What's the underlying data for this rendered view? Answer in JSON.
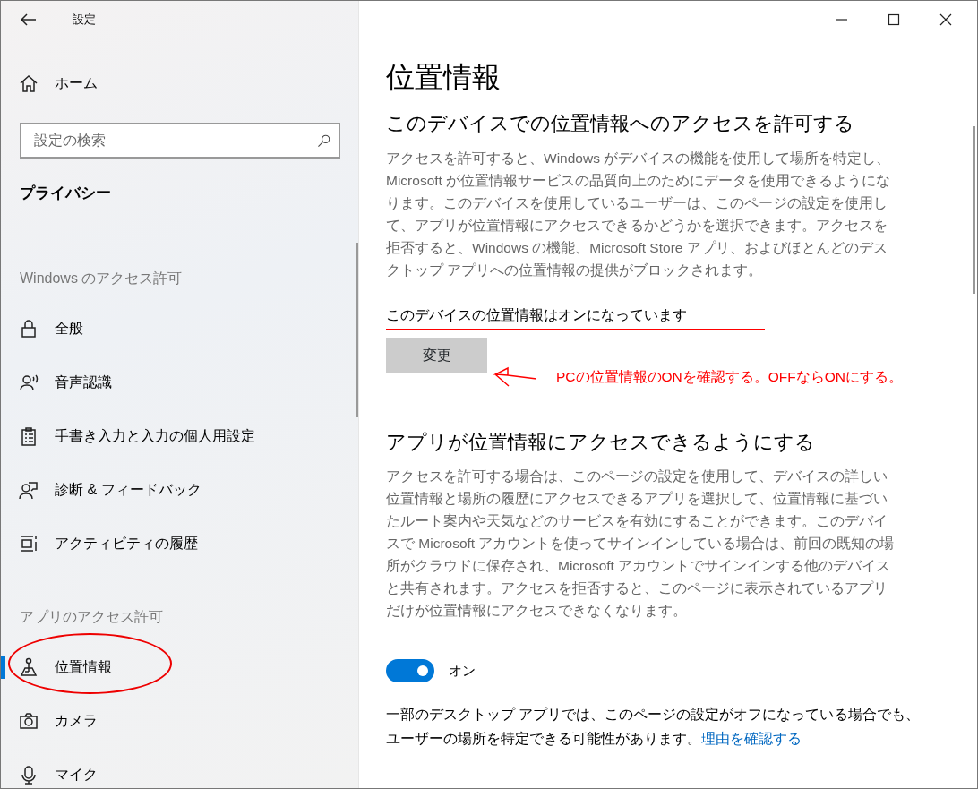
{
  "window": {
    "title": "設定"
  },
  "sidebar": {
    "home": {
      "label": "ホーム"
    },
    "search": {
      "placeholder": "設定の検索"
    },
    "section": "プライバシー",
    "groups": [
      {
        "heading": "Windows のアクセス許可",
        "items": [
          {
            "label": "全般",
            "kind": "lock",
            "selected": false
          },
          {
            "label": "音声認識",
            "kind": "speech",
            "selected": false
          },
          {
            "label": "手書き入力と入力の個人用設定",
            "kind": "clipboard",
            "selected": false
          },
          {
            "label": "診断 & フィードバック",
            "kind": "feedback",
            "selected": false
          },
          {
            "label": "アクティビティの履歴",
            "kind": "timeline",
            "selected": false
          }
        ]
      },
      {
        "heading": "アプリのアクセス許可",
        "items": [
          {
            "label": "位置情報",
            "kind": "location",
            "selected": true
          },
          {
            "label": "カメラ",
            "kind": "camera",
            "selected": false
          },
          {
            "label": "マイク",
            "kind": "mic",
            "selected": false
          }
        ]
      }
    ]
  },
  "main": {
    "title": "位置情報",
    "device_section": {
      "heading": "このデバイスでの位置情報へのアクセスを許可する",
      "description": "アクセスを許可すると、Windows がデバイスの機能を使用して場所を特定し、Microsoft が位置情報サービスの品質向上のためにデータを使用できるようになります。このデバイスを使用しているユーザーは、このページの設定を使用して、アプリが位置情報にアクセスできるかどうかを選択できます。アクセスを拒否すると、Windows の機能、Microsoft Store アプリ、およびほとんどのデスクトップ アプリへの位置情報の提供がブロックされます。",
      "status": "このデバイスの位置情報はオンになっています",
      "button": "変更"
    },
    "app_section": {
      "heading": "アプリが位置情報にアクセスできるようにする",
      "description": "アクセスを許可する場合は、このページの設定を使用して、デバイスの詳しい位置情報と場所の履歴にアクセスできるアプリを選択して、位置情報に基づいたルート案内や天気などのサービスを有効にすることができます。このデバイスで Microsoft アカウントを使ってサインインしている場合は、前回の既知の場所がクラウドに保存され、Microsoft アカウントでサインインする他のデバイスと共有されます。アクセスを拒否すると、このページに表示されているアプリだけが位置情報にアクセスできなくなります。",
      "toggle": {
        "on": true,
        "label": "オン"
      },
      "note": "一部のデスクトップ アプリでは、このページの設定がオフになっている場合でも、ユーザーの場所を特定できる可能性があります。",
      "link": "理由を確認する"
    }
  },
  "annotation": {
    "text": "PCの位置情報のONを確認する。OFFならONにする。"
  }
}
